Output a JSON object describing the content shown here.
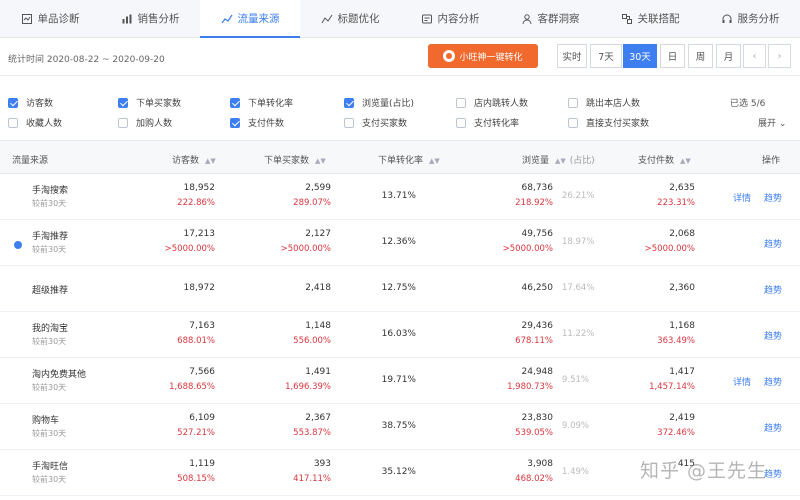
{
  "tabs": [
    {
      "label": "单品诊断",
      "icon": "diagnosis-icon"
    },
    {
      "label": "销售分析",
      "icon": "sales-icon"
    },
    {
      "label": "流量来源",
      "icon": "traffic-icon",
      "active": true
    },
    {
      "label": "标题优化",
      "icon": "title-icon"
    },
    {
      "label": "内容分析",
      "icon": "content-icon"
    },
    {
      "label": "客群洞察",
      "icon": "audience-icon"
    },
    {
      "label": "关联搭配",
      "icon": "link-icon"
    },
    {
      "label": "服务分析",
      "icon": "service-icon"
    }
  ],
  "date_range": "统计时间 2020-08-22 ~ 2020-09-20",
  "promo_label": "小旺神一键转化",
  "period_buttons": [
    "实时",
    "7天",
    "30天",
    "日",
    "周",
    "月"
  ],
  "active_period": "30天",
  "nav": {
    "prev": "‹",
    "next": "›"
  },
  "metrics": [
    {
      "label": "访客数",
      "checked": true
    },
    {
      "label": "下单买家数",
      "checked": true
    },
    {
      "label": "下单转化率",
      "checked": true
    },
    {
      "label": "浏览量(占比)",
      "checked": true
    },
    {
      "label": "店内跳转人数",
      "checked": false
    },
    {
      "label": "跳出本店人数",
      "checked": false
    },
    {
      "label": "收藏人数",
      "checked": false
    },
    {
      "label": "加购人数",
      "checked": false
    },
    {
      "label": "支付件数",
      "checked": true
    },
    {
      "label": "支付买家数",
      "checked": false
    },
    {
      "label": "支付转化率",
      "checked": false
    },
    {
      "label": "直接支付买家数",
      "checked": false
    }
  ],
  "selected_count": "已选 5/6",
  "expand_label": "展开",
  "table": {
    "headers": {
      "source": "流量来源",
      "visitors": "访客数",
      "buyers": "下单买家数",
      "conv": "下单转化率",
      "views": "浏览量",
      "share": "(占比)",
      "paid": "支付件数",
      "ops": "操作"
    },
    "compare_label": "较前30天",
    "detail_label": "详情",
    "trend_label": "趋势",
    "rows": [
      {
        "name": "手淘搜索",
        "visitors": "18,952",
        "visitors_chg": "222.86%",
        "buyers": "2,599",
        "buyers_chg": "289.07%",
        "conv": "13.71%",
        "views": "68,736",
        "views_chg": "218.92%",
        "share": "26.21%",
        "paid": "2,635",
        "paid_chg": "223.31%",
        "detail": true,
        "compare": true
      },
      {
        "name": "手淘推荐",
        "visitors": "17,213",
        "visitors_chg": ">5000.00%",
        "buyers": "2,127",
        "buyers_chg": ">5000.00%",
        "conv": "12.36%",
        "views": "49,756",
        "views_chg": ">5000.00%",
        "share": "18.97%",
        "paid": "2,068",
        "paid_chg": ">5000.00%",
        "detail": false,
        "compare": true,
        "marked": true
      },
      {
        "name": "超级推荐",
        "visitors": "18,972",
        "visitors_chg": "",
        "buyers": "2,418",
        "buyers_chg": "",
        "conv": "12.75%",
        "views": "46,250",
        "views_chg": "",
        "share": "17.64%",
        "paid": "2,360",
        "paid_chg": "",
        "detail": false,
        "compare": false
      },
      {
        "name": "我的淘宝",
        "visitors": "7,163",
        "visitors_chg": "688.01%",
        "buyers": "1,148",
        "buyers_chg": "556.00%",
        "conv": "16.03%",
        "views": "29,436",
        "views_chg": "678.11%",
        "share": "11.22%",
        "paid": "1,168",
        "paid_chg": "363.49%",
        "detail": false,
        "compare": true
      },
      {
        "name": "淘内免费其他",
        "visitors": "7,566",
        "visitors_chg": "1,688.65%",
        "buyers": "1,491",
        "buyers_chg": "1,696.39%",
        "conv": "19.71%",
        "views": "24,948",
        "views_chg": "1,980.73%",
        "share": "9.51%",
        "paid": "1,417",
        "paid_chg": "1,457.14%",
        "detail": true,
        "compare": true
      },
      {
        "name": "购物车",
        "visitors": "6,109",
        "visitors_chg": "527.21%",
        "buyers": "2,367",
        "buyers_chg": "553.87%",
        "conv": "38.75%",
        "views": "23,830",
        "views_chg": "539.05%",
        "share": "9.09%",
        "paid": "2,419",
        "paid_chg": "372.46%",
        "detail": false,
        "compare": true
      },
      {
        "name": "手淘旺信",
        "visitors": "1,119",
        "visitors_chg": "508.15%",
        "buyers": "393",
        "buyers_chg": "417.11%",
        "conv": "35.12%",
        "views": "3,908",
        "views_chg": "468.02%",
        "share": "1.49%",
        "paid": "415",
        "paid_chg": "",
        "detail": false,
        "compare": true
      }
    ]
  },
  "watermark": "知乎 @王先生",
  "colors": {
    "accent": "#3d7ff0",
    "promo": "#f2692d",
    "negative_change": "#d9363e"
  }
}
